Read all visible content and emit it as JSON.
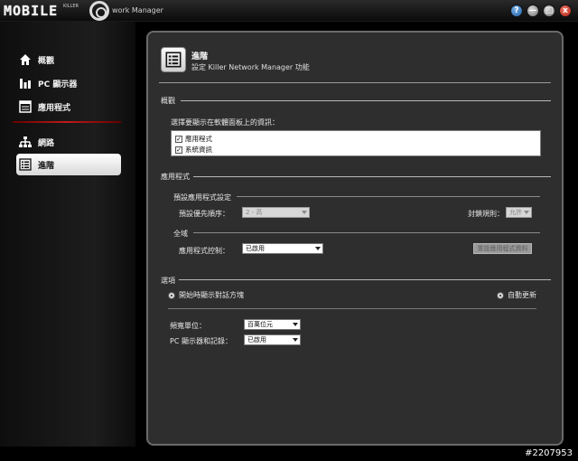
{
  "titlebar": {
    "logo_text": "MOBILE",
    "logo_sub": "KILLER",
    "app_title": "work Manager",
    "buttons": [
      "?",
      "—",
      "□",
      "x"
    ]
  },
  "sidebar": {
    "items": [
      {
        "label": "概觀",
        "icon": "home-icon"
      },
      {
        "label": "PC 顯示器",
        "icon": "bar-chart-icon"
      },
      {
        "label": "應用程式",
        "icon": "app-window-icon"
      },
      {
        "label": "網路",
        "icon": "network-icon"
      },
      {
        "label": "進階",
        "icon": "list-icon"
      }
    ],
    "active_index": 4
  },
  "header": {
    "title": "進階",
    "subtitle": "設定 Killer Network Manager 功能"
  },
  "overview": {
    "section_title": "概觀",
    "prompt": "選擇要顯示在軟體面板上的資訊：",
    "options": [
      {
        "label": "應用程式",
        "checked": true
      },
      {
        "label": "系統資訊",
        "checked": true
      }
    ]
  },
  "applications": {
    "section_title": "應用程式",
    "defaults_title": "預設應用程式設定",
    "priority_label": "預設優先順序：",
    "priority_value": "2 - 高",
    "block_label": "封鎖規則：",
    "block_value": "允許",
    "global_title": "全域",
    "control_label": "應用程式控制：",
    "control_value": "已啟用",
    "reset_button": "重設應用程式資料"
  },
  "options": {
    "section_title": "選項",
    "startup_dialog": "開始時顯示對話方塊",
    "auto_update": "自動更新",
    "bandwidth_label": "頻寬單位：",
    "bandwidth_value": "百萬位元",
    "monitor_label": "PC 顯示器和記錄：",
    "monitor_value": "已啟用"
  },
  "watermark": "#2207953",
  "colors": {
    "accent_red": "#c21a1a",
    "panel_bg": "#2e2e2e",
    "active_nav_bg": "#ffffff"
  }
}
